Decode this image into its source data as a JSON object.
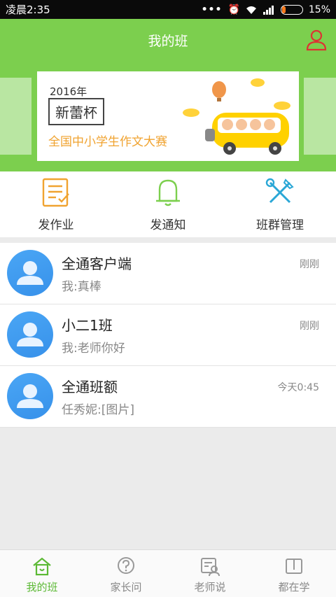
{
  "status": {
    "time": "凌晨2:35",
    "battery": "15%"
  },
  "header": {
    "title": "我的班"
  },
  "banner": {
    "year": "2016年",
    "cup": "新蕾杯",
    "subtitle": "全国中小学生作文大赛"
  },
  "actions": [
    {
      "label": "发作业",
      "icon": "homework-icon"
    },
    {
      "label": "发通知",
      "icon": "bell-icon"
    },
    {
      "label": "班群管理",
      "icon": "tools-icon"
    }
  ],
  "chats": [
    {
      "name": "全通客户端",
      "message": "我:真棒",
      "time": "刚刚"
    },
    {
      "name": "小二1班",
      "message": "我:老师你好",
      "time": "刚刚"
    },
    {
      "name": "全通班额",
      "message": "任秀妮:[图片]",
      "time": "今天0:45"
    }
  ],
  "nav": [
    {
      "label": "我的班",
      "active": true
    },
    {
      "label": "家长问",
      "active": false
    },
    {
      "label": "老师说",
      "active": false
    },
    {
      "label": "都在学",
      "active": false
    }
  ],
  "colors": {
    "primary": "#7ccf4e",
    "accent": "#f0a330",
    "avatar": "#3f9bf0"
  }
}
